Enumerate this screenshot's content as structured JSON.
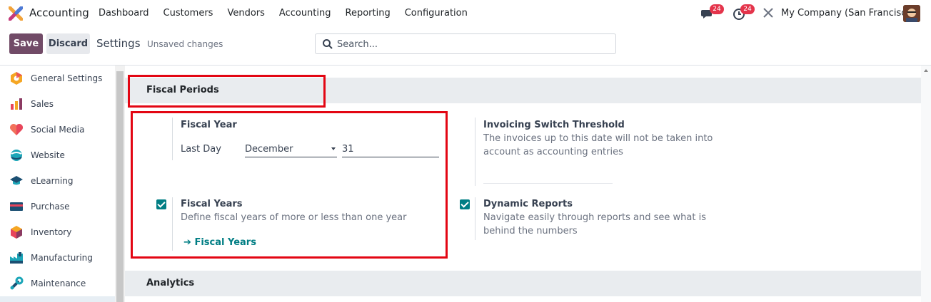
{
  "navbar": {
    "app_name": "Accounting",
    "menu": [
      "Dashboard",
      "Customers",
      "Vendors",
      "Accounting",
      "Reporting",
      "Configuration"
    ],
    "messages_count": "24",
    "activities_count": "24",
    "company": "My Company (San Francisco)"
  },
  "control_panel": {
    "save_label": "Save",
    "discard_label": "Discard",
    "title": "Settings",
    "status": "Unsaved changes",
    "search_placeholder": "Search..."
  },
  "sidebar": {
    "items": [
      {
        "label": "General Settings",
        "icon": "general-settings-icon"
      },
      {
        "label": "Sales",
        "icon": "sales-icon"
      },
      {
        "label": "Social Media",
        "icon": "social-media-icon"
      },
      {
        "label": "Website",
        "icon": "website-icon"
      },
      {
        "label": "eLearning",
        "icon": "elearning-icon"
      },
      {
        "label": "Purchase",
        "icon": "purchase-icon"
      },
      {
        "label": "Inventory",
        "icon": "inventory-icon"
      },
      {
        "label": "Manufacturing",
        "icon": "manufacturing-icon"
      },
      {
        "label": "Maintenance",
        "icon": "maintenance-icon"
      }
    ]
  },
  "fiscal_periods": {
    "heading": "Fiscal Periods",
    "fiscal_year": {
      "title": "Fiscal Year",
      "last_day_label": "Last Day",
      "month": "December",
      "day": "31"
    },
    "invoicing_switch": {
      "title": "Invoicing Switch Threshold",
      "description": "The invoices up to this date will not be taken into account as accounting entries"
    },
    "fiscal_years": {
      "title": "Fiscal Years",
      "description": "Define fiscal years of more or less than one year",
      "checked": true,
      "link": "Fiscal Years"
    },
    "dynamic_reports": {
      "title": "Dynamic Reports",
      "description": "Navigate easily through reports and see what is behind the numbers",
      "checked": true
    }
  },
  "analytics": {
    "heading": "Analytics"
  },
  "colors": {
    "primary": "#714b67",
    "accent": "#017e84",
    "highlight": "#e30613",
    "badge": "#e4344b"
  }
}
